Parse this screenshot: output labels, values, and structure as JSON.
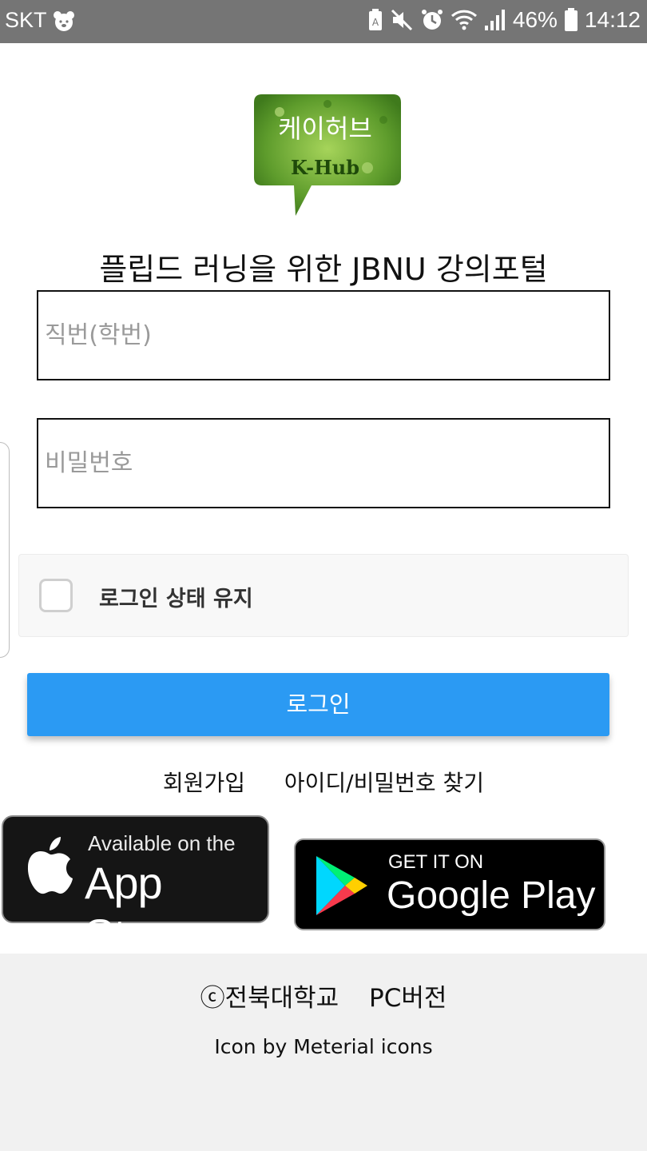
{
  "status_bar": {
    "carrier": "SKT",
    "battery": "46%",
    "time": "14:12"
  },
  "logo": {
    "korean": "케이허브",
    "english": "K-Hub"
  },
  "heading": "플립드 러닝을 위한 JBNU 강의포털",
  "form": {
    "id_placeholder": "직번(학번)",
    "password_placeholder": "비밀번호",
    "keep_login_label": "로그인 상태 유지",
    "keep_login_checked": false,
    "login_button": "로그인"
  },
  "links": {
    "signup": "회원가입",
    "find": "아이디/비밀번호 찾기"
  },
  "badges": {
    "appstore_small": "Available on the",
    "appstore_big": "App Store",
    "gplay_small": "GET IT ON",
    "gplay_big": "Google Play"
  },
  "footer": {
    "copyright": "ⓒ전북대학교",
    "pc_version": "PC버전",
    "credit": "Icon by Meterial icons"
  },
  "colors": {
    "status_bar": "#757575",
    "login_button": "#2b9af3",
    "footer_bg": "#f1f1f1"
  }
}
